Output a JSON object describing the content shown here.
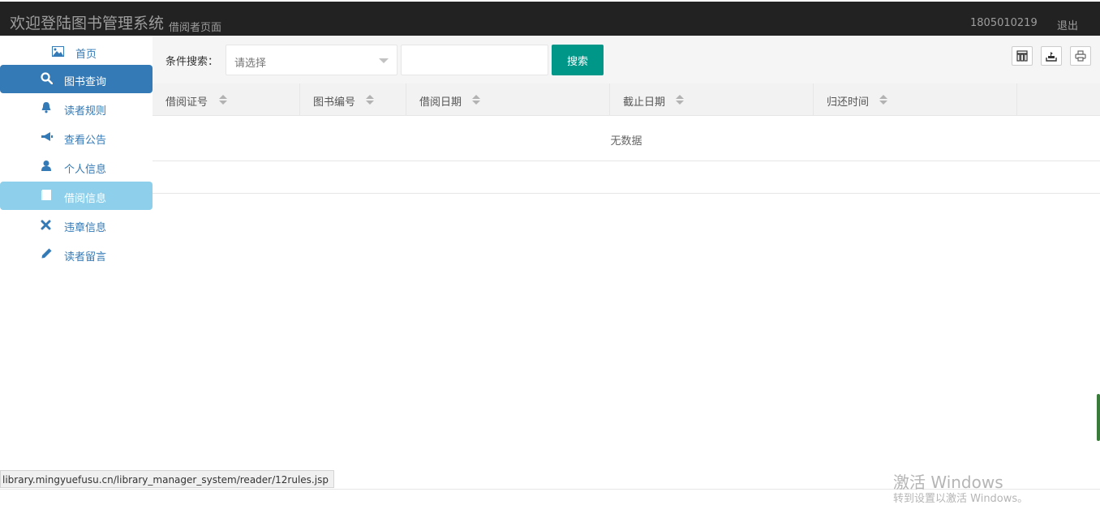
{
  "header": {
    "title": "欢迎登陆图书管理系统",
    "subtitle": "借阅者页面",
    "user_id": "1805010219",
    "logout_label": "退出"
  },
  "sidebar": {
    "items": [
      {
        "label": "首页",
        "icon": "image-icon"
      },
      {
        "label": "图书查询",
        "icon": "search-icon",
        "state": "active"
      },
      {
        "label": "读者规则",
        "icon": "bell-icon"
      },
      {
        "label": "查看公告",
        "icon": "bullhorn-icon"
      },
      {
        "label": "个人信息",
        "icon": "user-icon"
      },
      {
        "label": "借阅信息",
        "icon": "book-icon",
        "state": "hover"
      },
      {
        "label": "违章信息",
        "icon": "remove-icon"
      },
      {
        "label": "读者留言",
        "icon": "pencil-icon"
      }
    ]
  },
  "toolbar": {
    "condition_label": "条件搜索：",
    "select_value": "请选择",
    "search_value": "",
    "search_button": "搜索",
    "tools": [
      "columns-icon",
      "export-icon",
      "print-icon"
    ]
  },
  "table": {
    "columns": [
      "借阅证号",
      "图书编号",
      "借阅日期",
      "截止日期",
      "归还时间"
    ],
    "empty_text": "无数据"
  },
  "status_bar": {
    "url": "library.mingyuefusu.cn/library_manager_system/reader/12rules.jsp"
  },
  "watermark": {
    "line1": "激活 Windows",
    "line2": "转到设置以激活 Windows。"
  },
  "colors": {
    "topbar": "#222222",
    "primary": "#337ab7",
    "hover": "#8ed0eb",
    "search_button": "#009688"
  }
}
